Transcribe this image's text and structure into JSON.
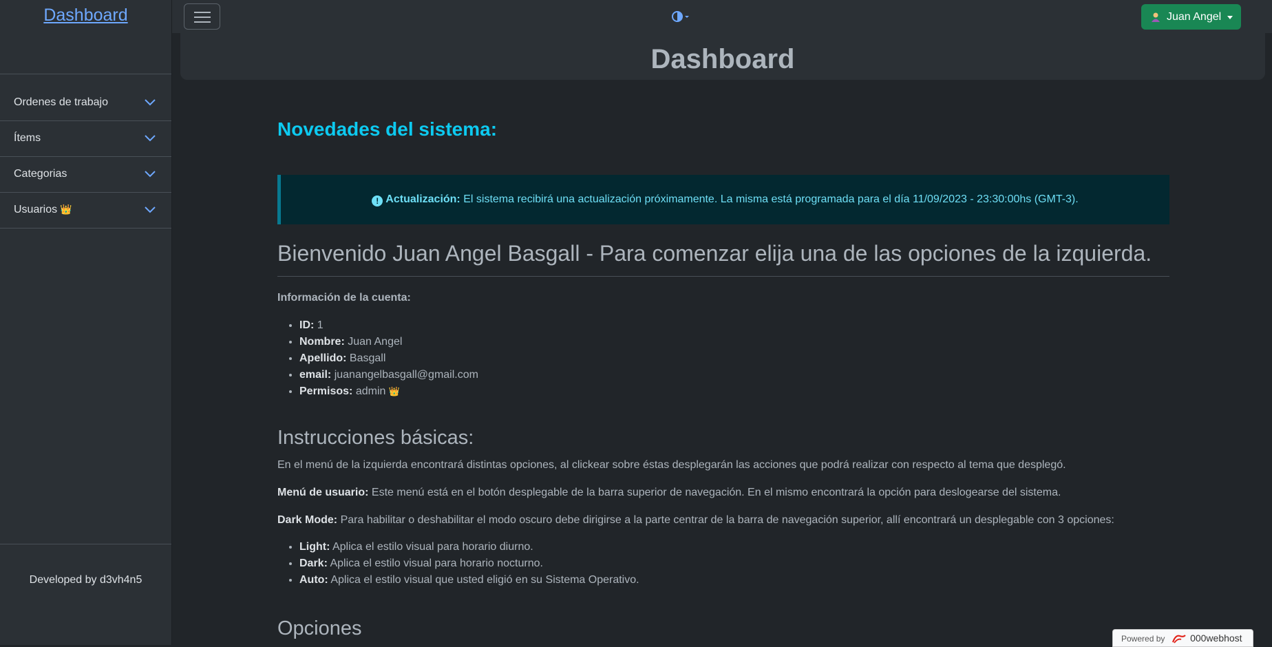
{
  "brand": {
    "title": "Dashboard"
  },
  "sidebar": {
    "items": [
      {
        "label": "Ordenes de trabajo"
      },
      {
        "label": "Ítems"
      },
      {
        "label": "Categorias"
      },
      {
        "label": "Usuarios"
      }
    ],
    "footer": "Developed by d3vh4n5"
  },
  "topbar": {
    "user_label": "Juan Angel"
  },
  "header": {
    "title": "Dashboard"
  },
  "news": {
    "title": "Novedades del sistema:",
    "alert_strong": "Actualización:",
    "alert_text": "El sistema recibirá una actualización próximamente. La misma está programada para el día 11/09/2023 - 23:30:00hs (GMT-3)."
  },
  "welcome": "Bienvenido Juan Angel Basgall - Para comenzar elija una de las opciones de la izquierda.",
  "account": {
    "title": "Información de la cuenta:",
    "fields": [
      {
        "label": "ID:",
        "value": "1"
      },
      {
        "label": "Nombre:",
        "value": "Juan Angel"
      },
      {
        "label": "Apellido:",
        "value": "Basgall"
      },
      {
        "label": "email:",
        "value": "juanangelbasgall@gmail.com"
      },
      {
        "label": "Permisos:",
        "value": "admin"
      }
    ]
  },
  "instructions": {
    "title": "Instrucciones básicas:",
    "p1": "En el menú de la izquierda encontrará distintas opciones, al clickear sobre éstas desplegarán las acciones que podrá realizar con respecto al tema que desplegó.",
    "p2_label": "Menú de usuario:",
    "p2": "Este menú está en el botón desplegable de la barra superior de navegación. En el mismo encontrará la opción para deslogearse del sistema.",
    "p3_label": "Dark Mode:",
    "p3": "Para habilitar o deshabilitar el modo oscuro debe dirigirse a la parte centrar de la barra de navegación superior, allí encontrará un desplegable con 3 opciones:",
    "modes": [
      {
        "label": "Light:",
        "text": "Aplica el estilo visual para horario diurno."
      },
      {
        "label": "Dark:",
        "text": "Aplica el estilo visual para horario nocturno."
      },
      {
        "label": "Auto:",
        "text": "Aplica el estilo visual que usted eligió en su Sistema Operativo."
      }
    ]
  },
  "options_title": "Opciones",
  "powered": {
    "prefix": "Powered by",
    "host": "000webhost"
  },
  "colors": {
    "accent": "#0dcaf0",
    "user_button": "#198754",
    "brand_link": "#6ea8fe"
  }
}
